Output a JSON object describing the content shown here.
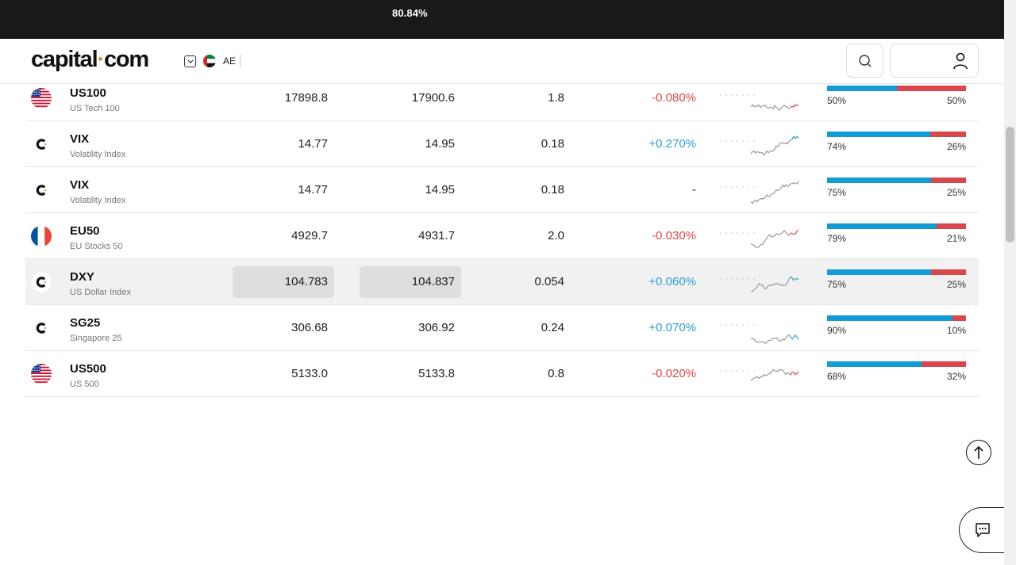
{
  "topbar": {
    "text": "80.84%"
  },
  "header": {
    "logo": {
      "main": "capital",
      "dot": "·",
      "tld": "com"
    },
    "region_code": "AE"
  },
  "markets": [
    {
      "symbol": "US100",
      "name": "US Tech 100",
      "icon": "flag-us-icon",
      "sell": "17898.8",
      "buy": "17900.6",
      "spread": "1.8",
      "change": "-0.080%",
      "direction": "neg",
      "buyers_pct": 50,
      "buy_label": "50%",
      "sell_label": "50%",
      "spark_end": "neg",
      "highlight": false
    },
    {
      "symbol": "VIX",
      "name": "Volatility Index",
      "icon": "capital-c-icon",
      "sell": "14.77",
      "buy": "14.95",
      "spread": "0.18",
      "change": "+0.270%",
      "direction": "pos",
      "buyers_pct": 74,
      "buy_label": "74%",
      "sell_label": "26%",
      "spark_end": "pos",
      "highlight": false
    },
    {
      "symbol": "VIX",
      "name": "Volatility Index",
      "icon": "capital-c-icon",
      "sell": "14.77",
      "buy": "14.95",
      "spread": "0.18",
      "change": "-",
      "direction": "none",
      "buyers_pct": 75,
      "buy_label": "75%",
      "sell_label": "25%",
      "spark_end": "none",
      "highlight": false
    },
    {
      "symbol": "EU50",
      "name": "EU Stocks 50",
      "icon": "flag-fr-icon",
      "sell": "4929.7",
      "buy": "4931.7",
      "spread": "2.0",
      "change": "-0.030%",
      "direction": "neg",
      "buyers_pct": 79,
      "buy_label": "79%",
      "sell_label": "21%",
      "spark_end": "neg",
      "highlight": false
    },
    {
      "symbol": "DXY",
      "name": "US Dollar Index",
      "icon": "capital-c-icon",
      "sell": "104.783",
      "buy": "104.837",
      "spread": "0.054",
      "change": "+0.060%",
      "direction": "pos",
      "buyers_pct": 75,
      "buy_label": "75%",
      "sell_label": "25%",
      "spark_end": "pos",
      "highlight": true
    },
    {
      "symbol": "SG25",
      "name": "Singapore 25",
      "icon": "capital-c-icon",
      "sell": "306.68",
      "buy": "306.92",
      "spread": "0.24",
      "change": "+0.070%",
      "direction": "pos",
      "buyers_pct": 90,
      "buy_label": "90%",
      "sell_label": "10%",
      "spark_end": "pos",
      "highlight": false
    },
    {
      "symbol": "US500",
      "name": "US 500",
      "icon": "flag-us-icon",
      "sell": "5133.0",
      "buy": "5133.8",
      "spread": "0.8",
      "change": "-0.020%",
      "direction": "neg",
      "buyers_pct": 68,
      "buy_label": "68%",
      "sell_label": "32%",
      "spark_end": "neg",
      "highlight": false
    }
  ],
  "colors": {
    "buy": "#119bd7",
    "sell": "#d8474b",
    "negative": "#e04545",
    "positive": "#2a9fd6",
    "spark": "#9a9a9a"
  }
}
